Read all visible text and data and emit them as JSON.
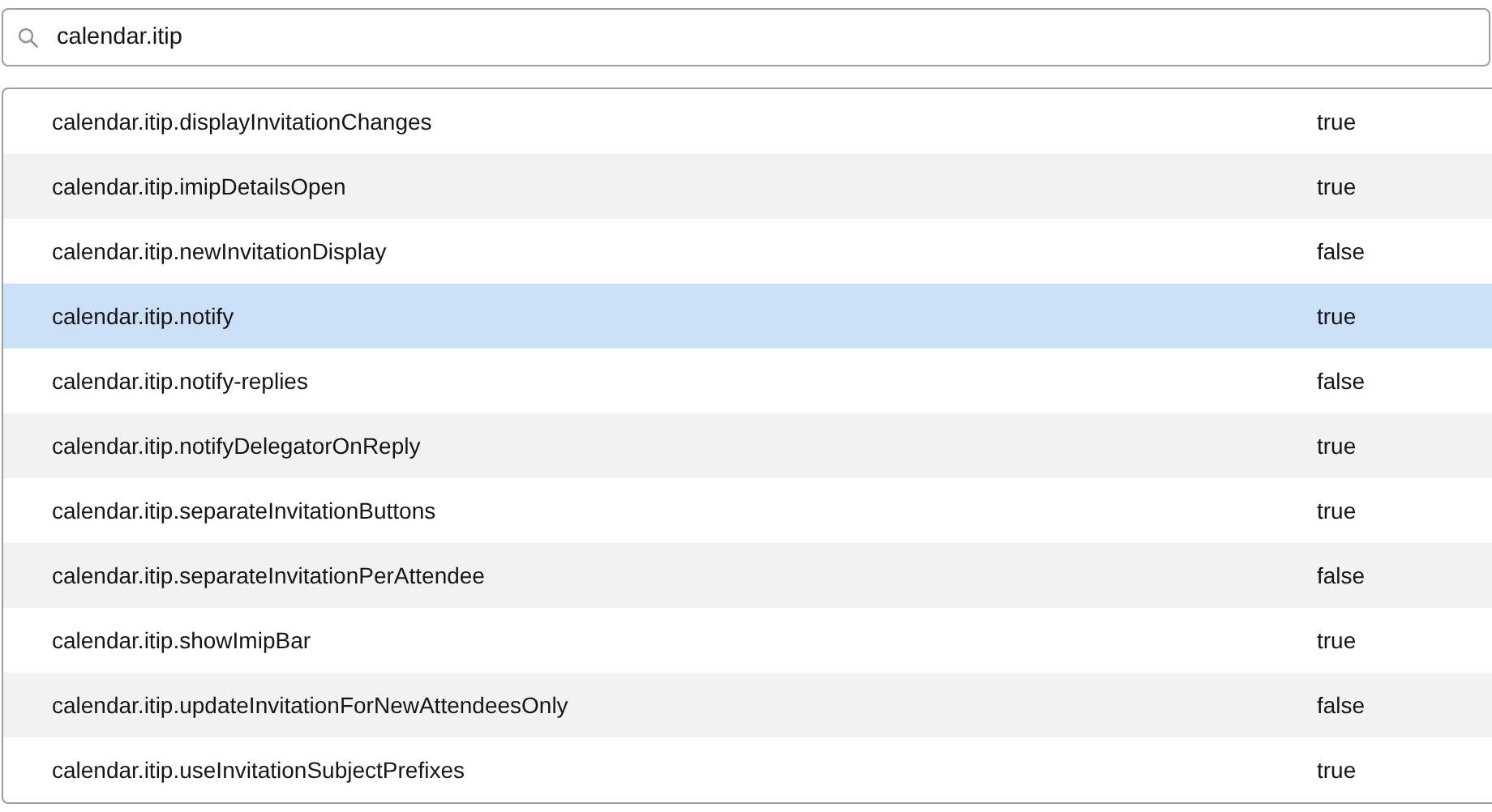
{
  "search": {
    "value": "calendar.itip"
  },
  "preferences": [
    {
      "name": "calendar.itip.displayInvitationChanges",
      "value": "true",
      "selected": false
    },
    {
      "name": "calendar.itip.imipDetailsOpen",
      "value": "true",
      "selected": false
    },
    {
      "name": "calendar.itip.newInvitationDisplay",
      "value": "false",
      "selected": false
    },
    {
      "name": "calendar.itip.notify",
      "value": "true",
      "selected": true
    },
    {
      "name": "calendar.itip.notify-replies",
      "value": "false",
      "selected": false
    },
    {
      "name": "calendar.itip.notifyDelegatorOnReply",
      "value": "true",
      "selected": false
    },
    {
      "name": "calendar.itip.separateInvitationButtons",
      "value": "true",
      "selected": false
    },
    {
      "name": "calendar.itip.separateInvitationPerAttendee",
      "value": "false",
      "selected": false
    },
    {
      "name": "calendar.itip.showImipBar",
      "value": "true",
      "selected": false
    },
    {
      "name": "calendar.itip.updateInvitationForNewAttendeesOnly",
      "value": "false",
      "selected": false
    },
    {
      "name": "calendar.itip.useInvitationSubjectPrefixes",
      "value": "true",
      "selected": false
    }
  ]
}
